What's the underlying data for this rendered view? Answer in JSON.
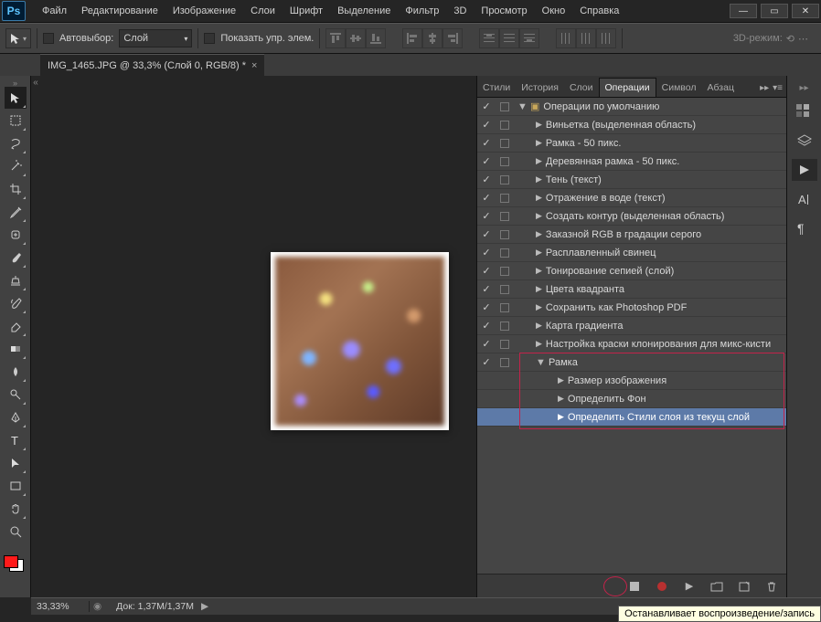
{
  "menu": [
    "Файл",
    "Редактирование",
    "Изображение",
    "Слои",
    "Шрифт",
    "Выделение",
    "Фильтр",
    "3D",
    "Просмотр",
    "Окно",
    "Справка"
  ],
  "options": {
    "autoselect": "Автовыбор:",
    "layer": "Слой",
    "show_controls": "Показать упр. элем.",
    "mode3d": "3D-режим:"
  },
  "doc_tab": "IMG_1465.JPG @ 33,3% (Слой 0, RGB/8) *",
  "panel_tabs": [
    "Стили",
    "История",
    "Слои",
    "Операции",
    "Символ",
    "Абзац"
  ],
  "actions": {
    "root": "Операции по умолчанию",
    "items": [
      "Виньетка (выделенная область)",
      "Рамка - 50 пикс.",
      "Деревянная рамка - 50 пикс.",
      "Тень (текст)",
      "Отражение в воде (текст)",
      "Создать контур (выделенная область)",
      "Заказной RGB в градации серого",
      "Расплавленный свинец",
      "Тонирование сепией (слой)",
      "Цвета квадранта",
      "Сохранить как Photoshop PDF",
      "Карта градиента",
      "Настройка краски клонирования для микс-кисти"
    ],
    "open_item": "Рамка",
    "sub": [
      "Размер изображения",
      "Определить Фон",
      "Определить Стили слоя из текущ слой"
    ]
  },
  "status": {
    "zoom": "33,33%",
    "doc": "Док: 1,37M/1,37M"
  },
  "tooltip": "Останавливает воспроизведение/запись"
}
